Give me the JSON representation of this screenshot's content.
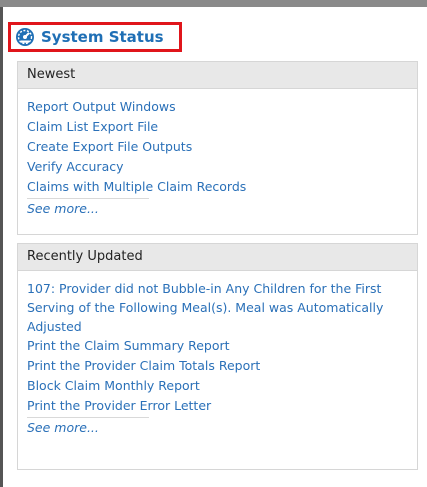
{
  "header": {
    "title": "System Status",
    "icon": "dashboard-gauge-icon",
    "accent_color": "#1f6fb5",
    "highlight_color": "#e0151b"
  },
  "newest": {
    "heading": "Newest",
    "items": [
      "Report Output Windows",
      "Claim List Export File",
      "Create Export File Outputs",
      "Verify Accuracy",
      "Claims with Multiple Claim Records"
    ],
    "see_more": "See more..."
  },
  "recently_updated": {
    "heading": "Recently Updated",
    "items": [
      "107: Provider did not Bubble-in Any Children for the First Serving of the Following Meal(s). Meal was Automatically Adjusted",
      "Print the Claim Summary Report",
      "Print the Provider Claim Totals Report",
      "Block Claim Monthly Report",
      "Print the Provider Error Letter"
    ],
    "see_more": "See more..."
  }
}
